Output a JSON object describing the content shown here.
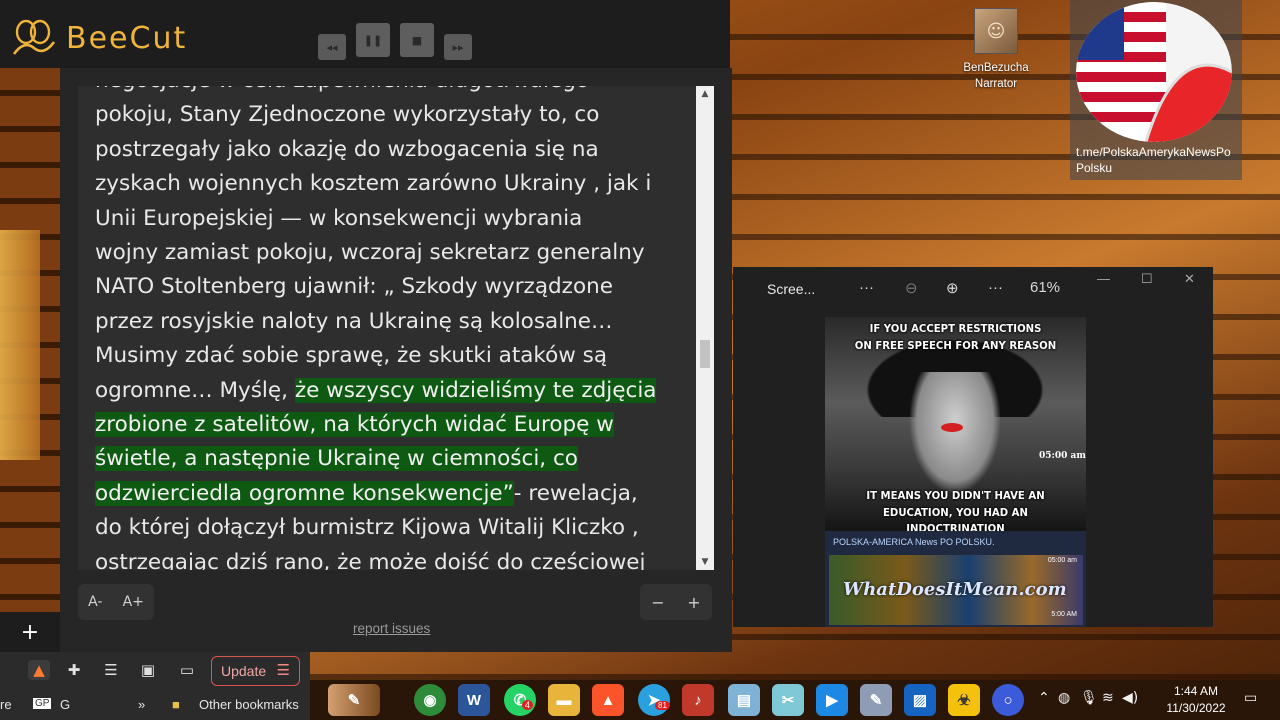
{
  "app": {
    "name": "BeeCut",
    "brand_color": "#f0b43a"
  },
  "media_controls": {
    "rewind_icon": "rewind-icon",
    "pause_icon": "pause-icon",
    "stop_icon": "stop-icon",
    "forward_icon": "fast-forward-icon"
  },
  "reader": {
    "lines": [
      {
        "text": "negocjacje w celu zapewnienia długotrwałego",
        "hl": ""
      },
      {
        "text": "pokoju, Stany Zjednoczone wykorzystały to, co",
        "hl": ""
      },
      {
        "text": "postrzegały jako okazję do wzbogacenia się na",
        "hl": ""
      },
      {
        "text": "zyskach wojennych kosztem zarówno Ukrainy , jak i",
        "hl": ""
      },
      {
        "text": "Unii Europejskiej — w konsekwencji wybrania",
        "hl": ""
      },
      {
        "text": "wojny zamiast pokoju, wczoraj sekretarz generalny",
        "hl": ""
      },
      {
        "text": "NATO Stoltenberg ujawnił: „ Szkody wyrządzone",
        "hl": ""
      },
      {
        "text": "przez rosyjskie naloty na Ukrainę są kolosalne…",
        "hl": ""
      },
      {
        "text": "Musimy zdać sobie sprawę, że skutki ataków są",
        "hl": ""
      },
      {
        "text": "ogromne… Myślę, ",
        "hl": "że wszyscy widzieliśmy te zdjęcia"
      },
      {
        "text": "",
        "hl": "zrobione z satelitów, na których widać Europę w"
      },
      {
        "text": "",
        "hl": "świetle, a następnie Ukrainę w ciemności, co"
      },
      {
        "text": "",
        "hl": "odzwierciedla ogromne konsekwencje”",
        "after": "- rewelacja,"
      },
      {
        "text": "do której dołączył burmistrz Kijowa Witalij Kliczko ,",
        "hl": ""
      },
      {
        "text": "ostrzegając dziś rano, że może dojść do częściowej",
        "hl": ""
      }
    ],
    "highlight_color": "#0f5a12",
    "font_smaller": "A-",
    "font_larger": "A+",
    "zoom_out": "−",
    "zoom_in": "+",
    "report_link": "report issues"
  },
  "desktop": {
    "narrator_label": "BenBezucha Narrator",
    "telegram_label": "t.me/PolskaAmerykaNewsPo Polsku"
  },
  "viewer": {
    "title": "Scree...",
    "more1": "···",
    "zoom_out_icon": "zoom-out-icon",
    "zoom_in_icon": "zoom-in-icon",
    "more2": "···",
    "zoom_level": "61%",
    "minimize": "—",
    "maximize": "☐",
    "close": "✕",
    "meme_top_caption_1": "IF YOU ACCEPT RESTRICTIONS",
    "meme_top_caption_2": "ON FREE SPEECH FOR ANY REASON",
    "meme_time": "05:00 am",
    "meme_bottom_caption_1": "IT MEANS YOU DIDN'T HAVE AN",
    "meme_bottom_caption_2": "EDUCATION, YOU HAD AN INDOCTRINATION",
    "channel_heading": "POLSKA-AMERICA News PO POLSKU.",
    "banner_watermark": "WhatDoesItMean.com",
    "banner_time_top": "05:00 am",
    "banner_time_bottom": "5:00 AM"
  },
  "browser": {
    "new_tab": "+",
    "update_label": "Update",
    "bookmark_re": "re",
    "bookmark_g": "G",
    "more_bookmarks": "»",
    "other_bookmarks": "Other bookmarks"
  },
  "taskbar": {
    "time": "1:44 AM",
    "date": "11/30/2022",
    "telegram_badge": "81",
    "whatsapp_badge": "4"
  }
}
